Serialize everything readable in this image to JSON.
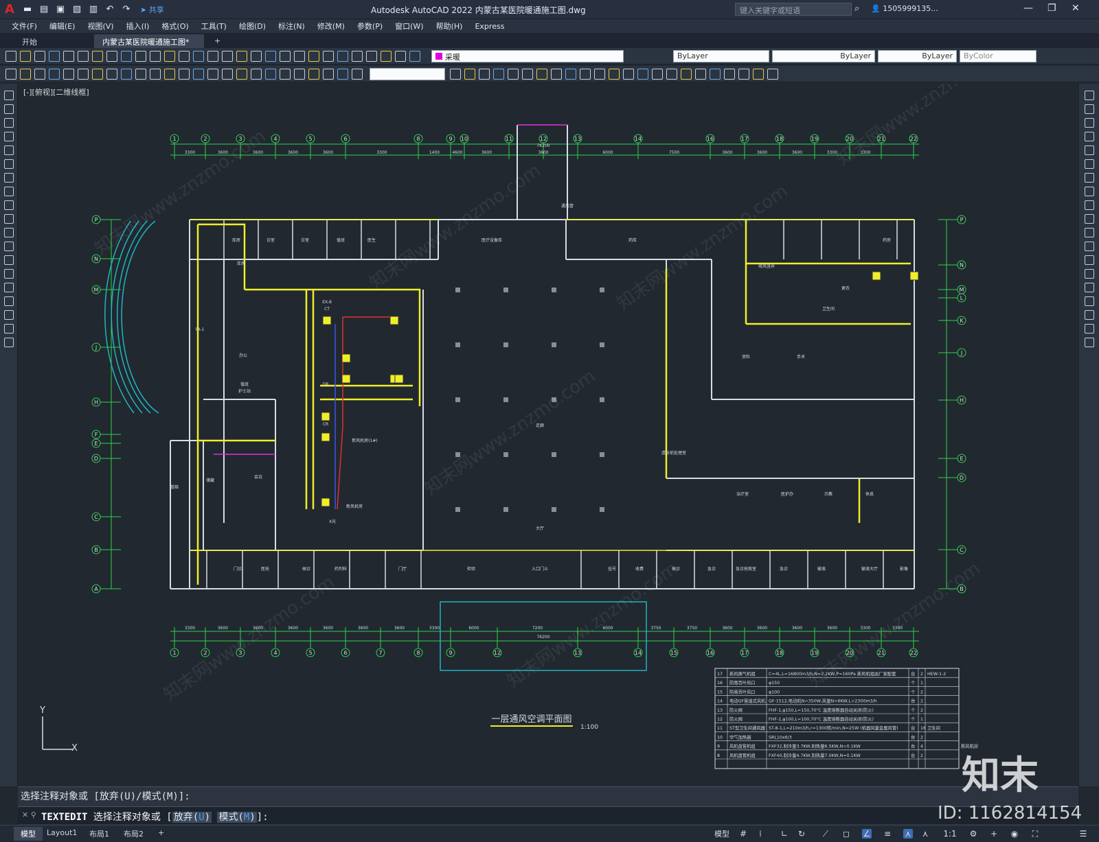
{
  "app": {
    "title": "Autodesk AutoCAD 2022    内蒙古某医院暖通施工图.dwg",
    "share_label": "共享",
    "search_placeholder": "键入关键字或短语",
    "user": "1505999135...",
    "logo": "A"
  },
  "menus": [
    "文件(F)",
    "编辑(E)",
    "视图(V)",
    "插入(I)",
    "格式(O)",
    "工具(T)",
    "绘图(D)",
    "标注(N)",
    "修改(M)",
    "参数(P)",
    "窗口(W)",
    "帮助(H)",
    "Express"
  ],
  "tabs": [
    {
      "label": "开始"
    },
    {
      "label": "内蒙古某医院暖通施工图*"
    }
  ],
  "new_tab_label": "+",
  "properties": {
    "layer": "采暖",
    "color": "ByLayer",
    "linetype": "ByLayer",
    "lineweight": "ByLayer",
    "plotstyle": "ByColor"
  },
  "viewport": {
    "label": "[-][俯视][二维线框]",
    "drawing_title": "一层通风空调平面图",
    "drawing_scale": "1:100"
  },
  "plan": {
    "grid_numbers": [
      "1",
      "2",
      "3",
      "4",
      "5",
      "6",
      "8",
      "9",
      "10",
      "11",
      "12",
      "13",
      "14",
      "16",
      "17",
      "18",
      "19",
      "20",
      "21",
      "22"
    ],
    "grid_numbers_bottom": [
      "1",
      "2",
      "3",
      "4",
      "5",
      "6",
      "7",
      "8",
      "9",
      "12",
      "13",
      "14",
      "15",
      "16",
      "17",
      "18",
      "19",
      "20",
      "21",
      "22"
    ],
    "grid_letters": [
      "P",
      "N",
      "M",
      "J",
      "H",
      "F",
      "E",
      "D",
      "C",
      "B",
      "A"
    ],
    "grid_letters_right": [
      "P",
      "N",
      "M",
      "L",
      "K",
      "J",
      "H",
      "E",
      "D",
      "C",
      "B",
      "A"
    ],
    "dims_top": [
      "3300",
      "3600",
      "3600",
      "3600",
      "3600",
      "3300",
      "1400",
      "4600",
      "3600",
      "3600",
      "6000",
      "7500",
      "3600",
      "3600",
      "3600",
      "3300",
      "3300"
    ],
    "dims_top_total": "7K200",
    "dims_bottom": [
      "3300",
      "3600",
      "3600",
      "3600",
      "3600",
      "3600",
      "3600",
      "3300",
      "6000",
      "7200",
      "6000",
      "3750",
      "3750",
      "3600",
      "3600",
      "3600",
      "3600",
      "3300",
      "3300"
    ],
    "dims_bottom_total": "76200",
    "rooms": [
      "库房",
      "诊室",
      "诊室",
      "值班",
      "医生",
      "医疗设备库",
      "药库",
      "药房",
      "大厅",
      "入口门斗",
      "门厅",
      "收费",
      "挂号",
      "候诊",
      "急诊",
      "急诊抢救室",
      "急诊",
      "输液",
      "输液大厅",
      "治疗室",
      "医护办",
      "示教",
      "休息",
      "资料",
      "手术",
      "更衣",
      "X光",
      "CT",
      "DR",
      "CR",
      "会议",
      "办公",
      "值班",
      "新风机房",
      "库房",
      "卫生间",
      "走廊",
      "楼梯",
      "储藏",
      "门诊",
      "医技",
      "候诊",
      "药剂科",
      "检验",
      "影像"
    ],
    "labels": [
      "透析前处理室",
      "护士站",
      "通风管",
      "新风机房(1#)",
      "排风竖井",
      "EX-8",
      "FA-1"
    ],
    "legend_rows": [
      [
        "17",
        "新风换气机组",
        "C=4L,L=16800m3/h,N=2.2KW,P=160Pa 新风机组由厂家配套",
        "台",
        "2",
        "HEW-1-2",
        ""
      ],
      [
        "16",
        "防雨百叶风口",
        "φ150",
        "个",
        "1",
        "",
        ""
      ],
      [
        "15",
        "防雨百叶风口",
        "φ100",
        "个",
        "2",
        "",
        ""
      ],
      [
        "14",
        "电动GF管道式风机",
        "GF-1512,电动机N=350W,风量N=6KW,L=2300m3/h",
        "台",
        "2",
        "",
        ""
      ],
      [
        "13",
        "防火阀",
        "FHF-1,φ150,L=150,70°C 温度熔断器自动关闭(防火)",
        "个",
        "2",
        "",
        ""
      ],
      [
        "12",
        "防火阀",
        "FHF-1,φ100,L=100,70°C 温度熔断器自动关闭(防火)",
        "个",
        "1",
        "",
        ""
      ],
      [
        "11",
        "ST型卫生间通风器",
        "ST-8-1,L=210m3/h,r=1300转/min,N=25W (机器风量金属风管)",
        "台",
        "16",
        "卫生间",
        ""
      ],
      [
        "10",
        "空气加热器",
        "SRL10x6/3",
        "台",
        "2",
        "",
        ""
      ],
      [
        "9",
        "风机盘管机组",
        "FXF32,制冷量3.7KW,制热量6.5KW,N=0.1KW",
        "台",
        "4",
        "",
        "新风机房"
      ],
      [
        "8",
        "风机盘管机组",
        "FXF40,制冷量4.7KW,制热量7.0KW,N=0.1KW",
        "台",
        "2",
        "",
        ""
      ]
    ]
  },
  "command": {
    "history": "选择注释对象或 [放弃(U)/模式(M)]:",
    "cmd_name": "TEXTEDIT",
    "prompt": "选择注释对象或 [",
    "opt1_pre": "放弃(",
    "opt1_key": "U",
    "opt1_post": ")",
    "opt2_pre": "模式(",
    "opt2_key": "M",
    "opt2_post": ")",
    "tail": "]:"
  },
  "status": {
    "tabs": [
      "模型",
      "Layout1",
      "布局1",
      "布局2"
    ],
    "add": "+",
    "model": "模型",
    "scale": "1:1"
  },
  "watermark": {
    "logo": "知末",
    "id": "ID: 1162814154",
    "text": "知末网www.znzmo.com"
  }
}
